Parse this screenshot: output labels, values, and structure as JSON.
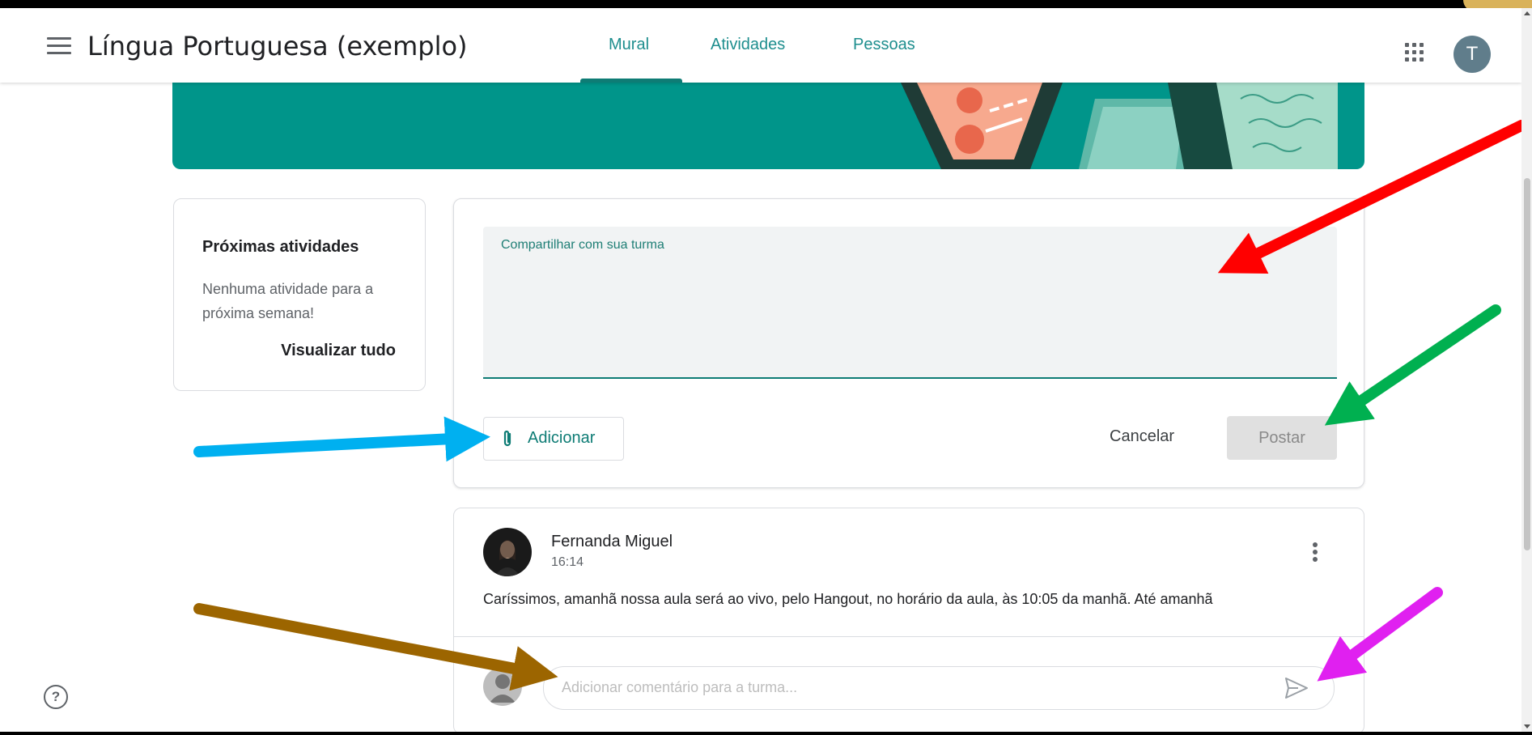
{
  "header": {
    "course_title": "Língua Portuguesa (exemplo)",
    "tabs": [
      {
        "label": "Mural",
        "active": true
      },
      {
        "label": "Atividades",
        "active": false
      },
      {
        "label": "Pessoas",
        "active": false
      }
    ],
    "avatar_initial": "T"
  },
  "upcoming": {
    "title": "Próximas atividades",
    "text": "Nenhuma atividade para a próxima semana!",
    "view_all": "Visualizar tudo"
  },
  "composer": {
    "label": "Compartilhar com sua turma",
    "add_label": "Adicionar",
    "cancel_label": "Cancelar",
    "post_label": "Postar"
  },
  "post": {
    "author": "Fernanda Miguel",
    "time": "16:14",
    "text": "Caríssimos, amanhã nossa aula será ao vivo, pelo Hangout, no horário da aula, às 10:05 da manhã. Até amanhã",
    "comment_placeholder": "Adicionar comentário para a turma..."
  },
  "icons": {
    "menu": "menu-icon",
    "apps": "apps-grid-icon",
    "attach": "paperclip-icon",
    "more": "more-vert-icon",
    "send": "send-icon",
    "help": "help-icon"
  },
  "colors": {
    "accent": "#0e7c75",
    "banner": "#00958a",
    "annotation_red": "#ff0000",
    "annotation_green": "#00b050",
    "annotation_blue": "#00b0f0",
    "annotation_brown": "#9c6500",
    "annotation_magenta": "#e020f0"
  }
}
